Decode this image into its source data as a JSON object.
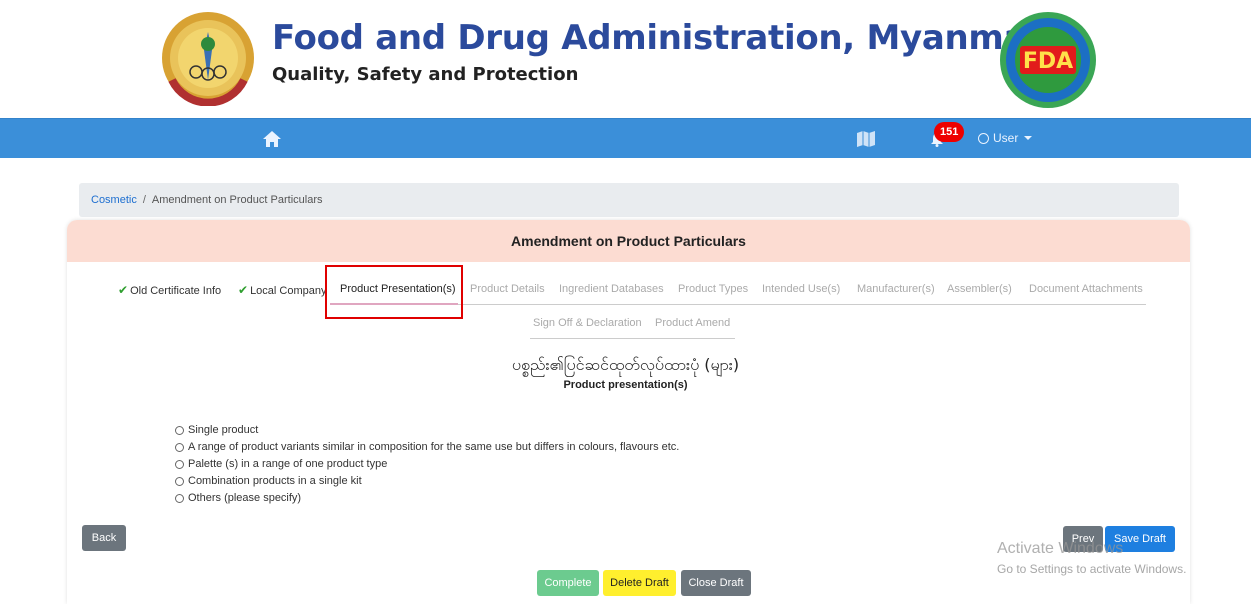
{
  "header": {
    "title": "Food and Drug Administration, Myanmar",
    "subtitle": "Quality, Safety and Protection",
    "left_logo": "ministry-of-health-seal",
    "right_logo": "fda-seal",
    "right_logo_text": "FDA"
  },
  "navbar": {
    "notification_count": "151",
    "user_label": "User",
    "color": "#3b8fd9"
  },
  "breadcrumb": {
    "root": "Cosmetic",
    "separator": "/",
    "current": "Amendment on Product Particulars"
  },
  "card": {
    "title": "Amendment on Product Particulars"
  },
  "tabs": [
    {
      "label": "Old Certificate Info",
      "state": "done"
    },
    {
      "label": "Local Company",
      "state": "done"
    },
    {
      "label": "Product Presentation(s)",
      "state": "active"
    },
    {
      "label": "Product Details",
      "state": "disabled"
    },
    {
      "label": "Ingredient Databases",
      "state": "disabled"
    },
    {
      "label": "Product Types",
      "state": "disabled"
    },
    {
      "label": "Intended Use(s)",
      "state": "disabled"
    },
    {
      "label": "Manufacturer(s)",
      "state": "disabled"
    },
    {
      "label": "Assembler(s)",
      "state": "disabled"
    },
    {
      "label": "Document Attachments",
      "state": "disabled"
    },
    {
      "label": "Sign Off & Declaration",
      "state": "disabled"
    },
    {
      "label": "Product Amend",
      "state": "disabled"
    }
  ],
  "section": {
    "title_mm": "ပစ္စည်း၏ပြင်ဆင်ထုတ်လုပ်ထားပုံ (များ)",
    "title_en": "Product presentation(s)"
  },
  "options": [
    "Single product",
    "A range of product variants similar in composition for the same use but differs in colours, flavours etc.",
    "Palette (s) in a range of one product type",
    "Combination products in a single kit",
    "Others (please specify)"
  ],
  "buttons": {
    "back": "Back",
    "prev": "Prev",
    "save_draft": "Save Draft",
    "complete": "Complete",
    "delete_draft": "Delete Draft",
    "close_draft": "Close Draft"
  },
  "watermark": {
    "line1": "Activate Windows",
    "line2": "Go to Settings to activate Windows."
  }
}
